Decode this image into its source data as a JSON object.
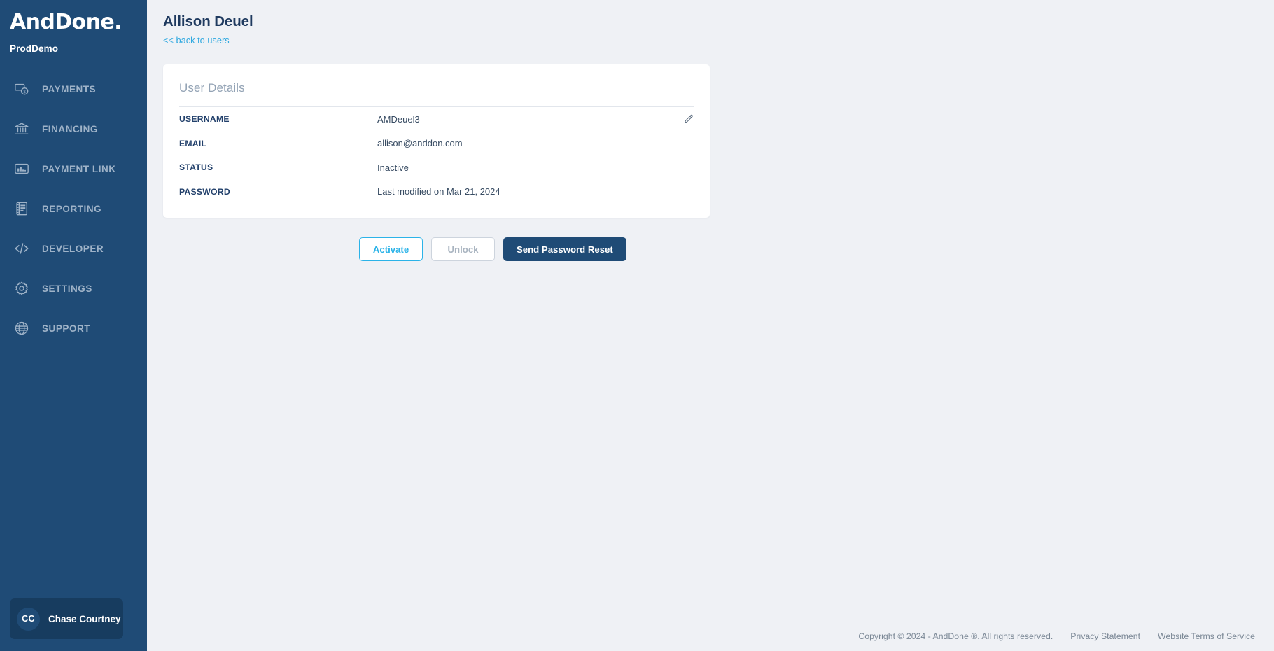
{
  "sidebar": {
    "logo_text": "AndDone",
    "logo_suffix": ".",
    "environment_label": "ProdDemo",
    "items": [
      {
        "label": "PAYMENTS",
        "icon": "payments-icon"
      },
      {
        "label": "FINANCING",
        "icon": "bank-icon"
      },
      {
        "label": "PAYMENT LINK",
        "icon": "payment-link-icon"
      },
      {
        "label": "REPORTING",
        "icon": "report-icon"
      },
      {
        "label": "DEVELOPER",
        "icon": "code-icon"
      },
      {
        "label": "SETTINGS",
        "icon": "gear-icon"
      },
      {
        "label": "SUPPORT",
        "icon": "globe-icon"
      }
    ],
    "user": {
      "initials": "CC",
      "name": "Chase Courtney"
    }
  },
  "header": {
    "title": "Allison Deuel",
    "back_link": "<< back to users"
  },
  "card": {
    "title": "User Details",
    "edit_icon": "pencil-icon",
    "rows": [
      {
        "label": "USERNAME",
        "value": "AMDeuel3",
        "has_edit": true
      },
      {
        "label": "EMAIL",
        "value": "allison@anddon.com",
        "has_edit": false
      },
      {
        "label": "STATUS",
        "value": "Inactive",
        "has_edit": false
      },
      {
        "label": "PASSWORD",
        "value": "Last modified on Mar 21, 2024",
        "has_edit": false
      }
    ]
  },
  "actions": {
    "activate_label": "Activate",
    "unlock_label": "Unlock",
    "reset_label": "Send Password Reset"
  },
  "footer": {
    "copyright": "Copyright © 2024 - AndDone ®. All rights reserved.",
    "privacy_label": "Privacy Statement",
    "terms_label": "Website Terms of Service"
  },
  "colors": {
    "sidebar_navy": "#1f4b76",
    "page_background": "#eff1f5",
    "accent_cyan": "#2bb3e8",
    "link_blue": "#30a9e0",
    "title_navy": "#1f3a5f",
    "muted_gray": "#93a3b5"
  }
}
